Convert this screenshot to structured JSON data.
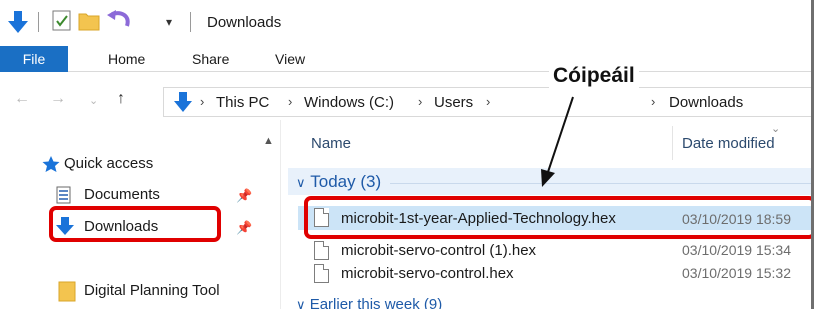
{
  "window": {
    "title": "Downloads"
  },
  "ribbon": {
    "tabs": [
      {
        "label": "File"
      },
      {
        "label": "Home"
      },
      {
        "label": "Share"
      },
      {
        "label": "View"
      }
    ]
  },
  "address_bar": {
    "crumbs": [
      "This PC",
      "Windows (C:)",
      "Users",
      "Downloads"
    ]
  },
  "nav_pane": {
    "quick_access_label": "Quick access",
    "items": [
      {
        "label": "Documents",
        "pinned": true
      },
      {
        "label": "Downloads",
        "pinned": true
      },
      {
        "label": "Digital Planning Tool",
        "pinned": false
      }
    ]
  },
  "file_list": {
    "columns": {
      "name": "Name",
      "date_modified": "Date modified"
    },
    "group": {
      "label": "Today (3)"
    },
    "files": [
      {
        "name": "microbit-1st-year-Applied-Technology.hex",
        "date": "03/10/2019 18:59",
        "selected": true
      },
      {
        "name": "microbit-servo-control (1).hex",
        "date": "03/10/2019 15:34",
        "selected": false
      },
      {
        "name": "microbit-servo-control.hex",
        "date": "03/10/2019 15:32",
        "selected": false
      }
    ],
    "next_group": {
      "label": "Earlier this week (9)"
    }
  },
  "annotation": {
    "callout_label": "Cóipeáil",
    "highlight_color": "#e00000"
  },
  "colors": {
    "file_tab": "#1a6fc4",
    "selection": "#cce4f7",
    "accent_blue": "#1e5aa8"
  }
}
